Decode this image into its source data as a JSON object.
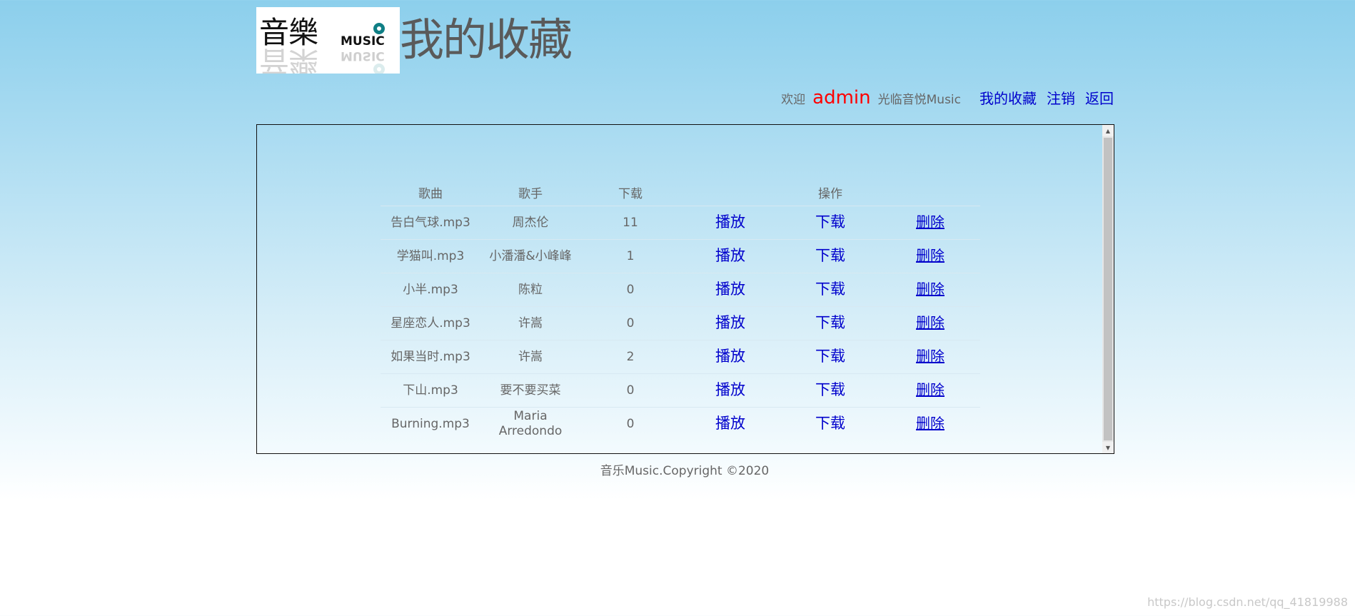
{
  "logo": {
    "cn_text": "音樂",
    "en_text": "MUSIC"
  },
  "page_title": "我的收藏",
  "user_bar": {
    "welcome": "欢迎",
    "username": "admin",
    "suffix": "光临音悦Music",
    "links": [
      "我的收藏",
      "注销",
      "返回"
    ]
  },
  "table": {
    "headers": {
      "song": "歌曲",
      "singer": "歌手",
      "downloads": "下载",
      "actions": "操作"
    },
    "action_labels": {
      "play": "播放",
      "download": "下载",
      "delete": "删除"
    },
    "rows": [
      {
        "song": "告白气球.mp3",
        "singer": "周杰伦",
        "downloads": "11"
      },
      {
        "song": "学猫叫.mp3",
        "singer": "小潘潘&小峰峰",
        "downloads": "1"
      },
      {
        "song": "小半.mp3",
        "singer": "陈粒",
        "downloads": "0"
      },
      {
        "song": "星座恋人.mp3",
        "singer": "许嵩",
        "downloads": "0"
      },
      {
        "song": "如果当时.mp3",
        "singer": "许嵩",
        "downloads": "2"
      },
      {
        "song": "下山.mp3",
        "singer": "要不要买菜",
        "downloads": "0"
      },
      {
        "song": "Burning.mp3",
        "singer": "Maria Arredondo",
        "downloads": "0"
      }
    ]
  },
  "footer": "音乐Music.Copyright ©2020",
  "watermark": "https://blog.csdn.net/qq_41819988",
  "colors": {
    "link": "#0000cc",
    "username": "#ff0000",
    "bg_top": "#8ccfec"
  }
}
